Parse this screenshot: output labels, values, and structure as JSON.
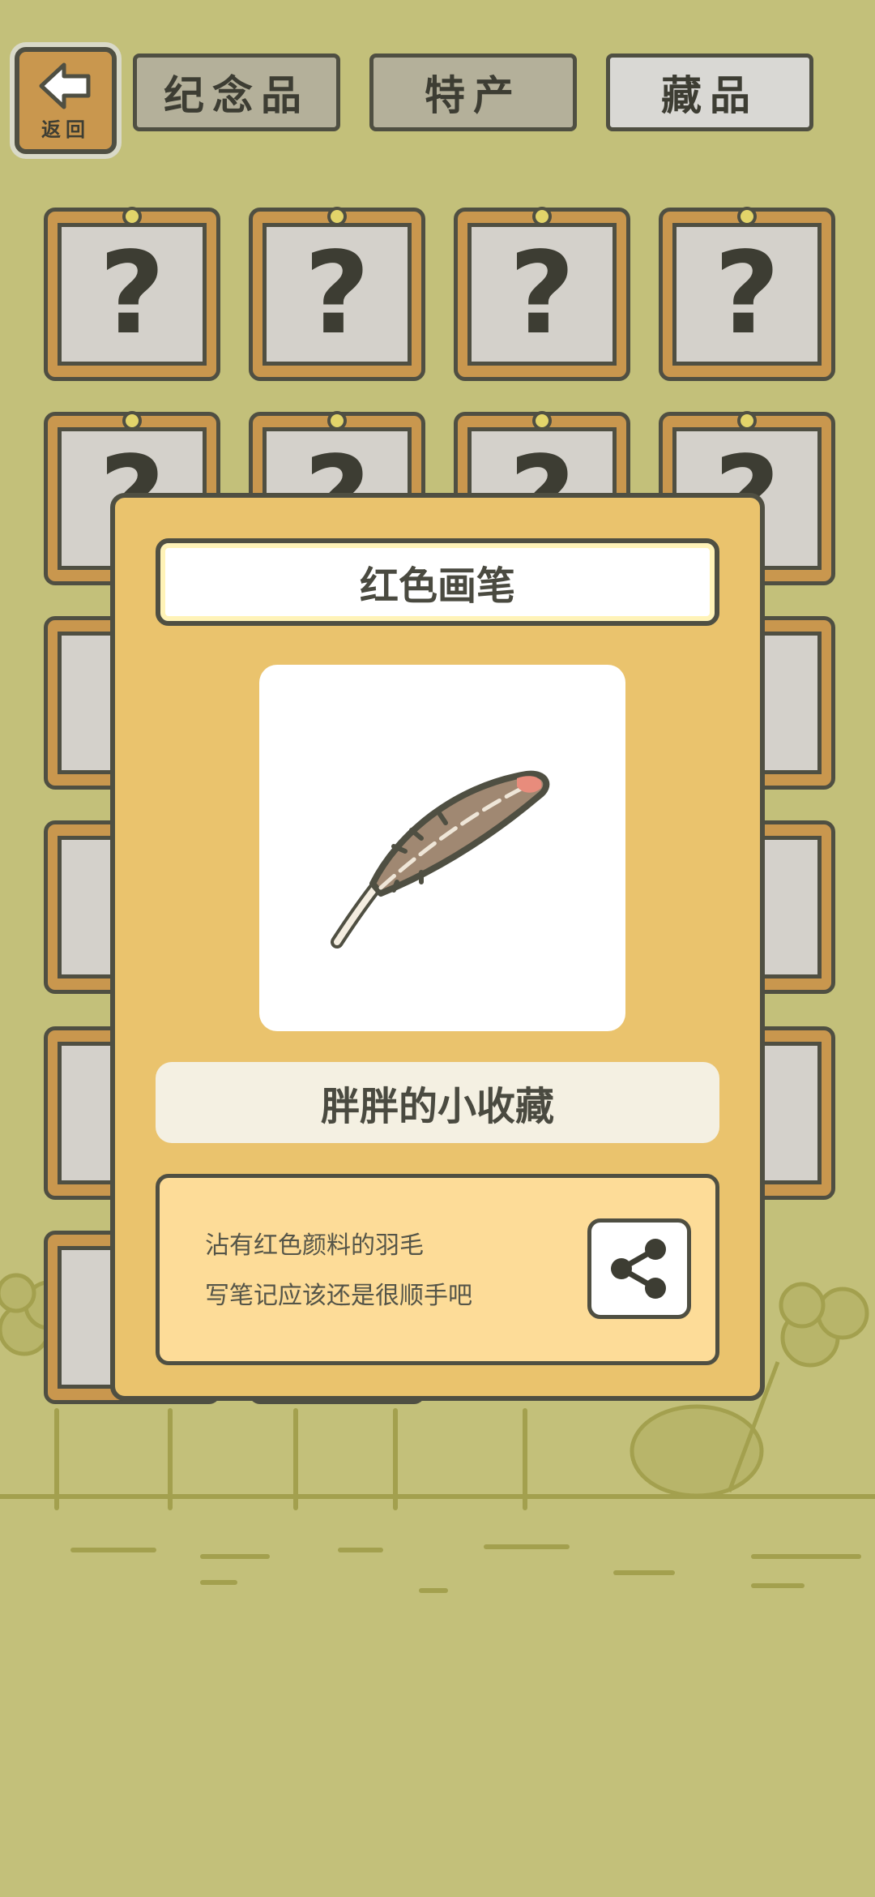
{
  "header": {
    "back_label": "返回",
    "tabs": [
      {
        "label": "纪念品",
        "active": false
      },
      {
        "label": "特产",
        "active": false
      },
      {
        "label": "藏品",
        "active": true
      }
    ]
  },
  "grid": {
    "locked_symbol": "?"
  },
  "modal": {
    "title": "红色画笔",
    "item_icon": "red-tipped-feather",
    "category": "胖胖的小收藏",
    "description": [
      "沾有红色颜料的羽毛",
      "写笔记应该还是很顺手吧"
    ],
    "share_icon": "share-icon"
  },
  "colors": {
    "background": "#c3c07a",
    "card_frame": "#c9974e",
    "modal_bg": "#eac36d",
    "outline": "#4f4f42"
  }
}
